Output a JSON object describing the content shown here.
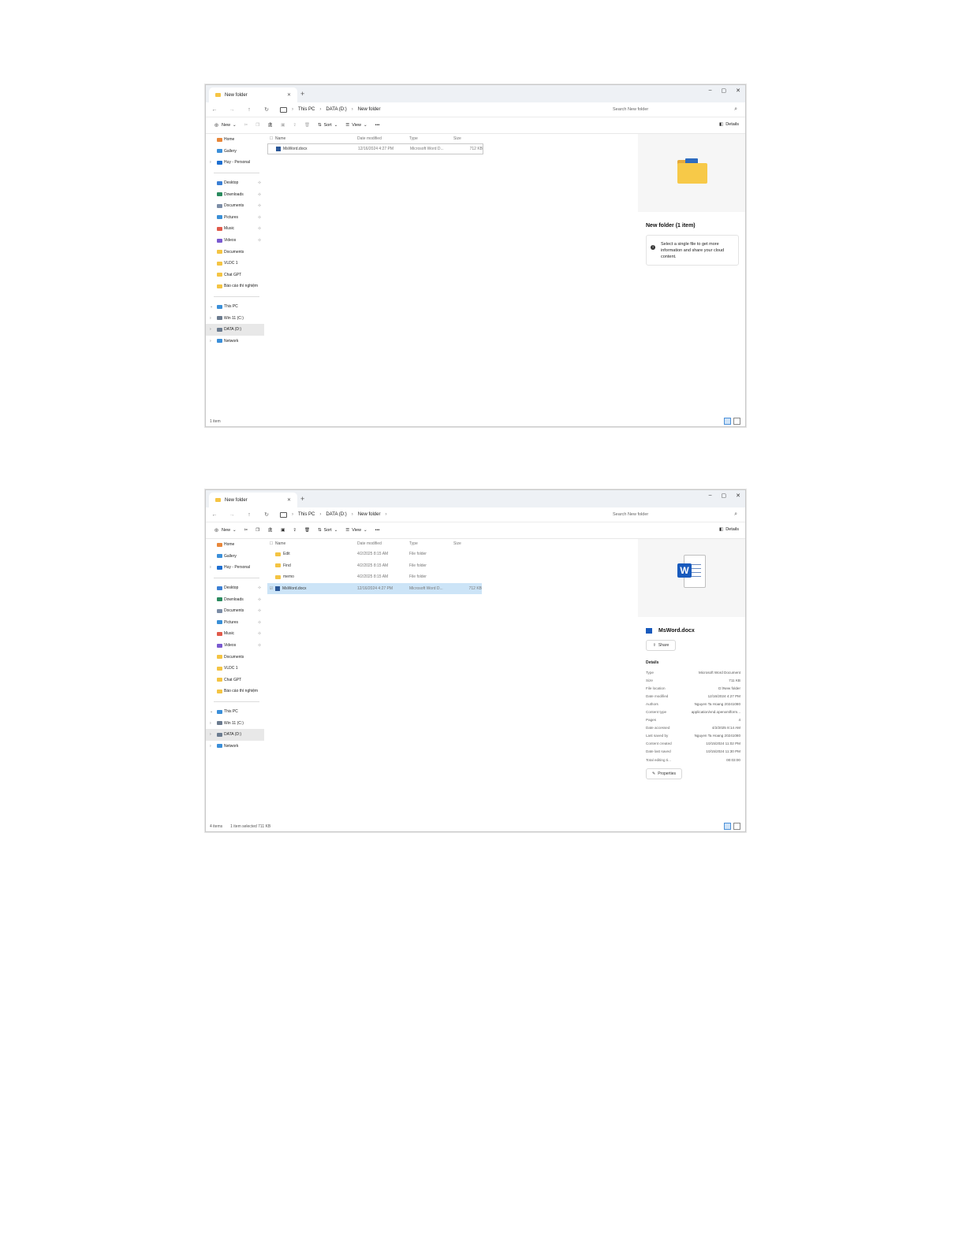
{
  "windows": [
    {
      "title": "New folder",
      "search_placeholder": "Search New folder",
      "breadcrumb": [
        "This PC",
        "DATA (D:)",
        "New folder"
      ],
      "toolbar": {
        "new": "New",
        "sort": "Sort",
        "view": "View",
        "more": "•••",
        "details": "Details"
      },
      "columns": {
        "name": "Name",
        "date": "Date modified",
        "type": "Type",
        "size": "Size"
      },
      "sidebar": {
        "top": [
          {
            "label": "Home",
            "color": "#e8873a"
          },
          {
            "label": "Gallery",
            "color": "#3b8fd9"
          },
          {
            "label": "Huy - Personal",
            "color": "#1e6fd1"
          }
        ],
        "quick": [
          {
            "label": "Desktop",
            "color": "#3b7fd4"
          },
          {
            "label": "Downloads",
            "color": "#2a8a5e"
          },
          {
            "label": "Documents",
            "color": "#7c8da6"
          },
          {
            "label": "Pictures",
            "color": "#3a8fd6"
          },
          {
            "label": "Music",
            "color": "#e05a4a"
          },
          {
            "label": "Videos",
            "color": "#7a5ad0"
          },
          {
            "label": "Documents",
            "color": "#f4c443"
          },
          {
            "label": "VLDC 1",
            "color": "#f4c443"
          },
          {
            "label": "Chat GPT",
            "color": "#f4c443"
          },
          {
            "label": "Báo cáo thí nghiệm",
            "color": "#f4c443"
          }
        ],
        "pc": [
          {
            "label": "This PC",
            "color": "#3b8fd9"
          },
          {
            "label": "Win 11 (C:)",
            "color": "#6b7b8f"
          },
          {
            "label": "DATA (D:)",
            "color": "#6b7b8f"
          },
          {
            "label": "Network",
            "color": "#3b8fd9"
          }
        ]
      },
      "files": [
        {
          "name": "MsWord.docx",
          "date": "12/16/2024 4:27 PM",
          "type": "Microsoft Word D...",
          "size": "712 KB",
          "kind": "word"
        }
      ],
      "details_title": "New folder (1 item)",
      "details_message": "Select a single file to get more information and share your cloud content.",
      "status": "1 item",
      "status_selected": ""
    },
    {
      "title": "New folder",
      "search_placeholder": "Search New folder",
      "breadcrumb": [
        "This PC",
        "DATA (D:)",
        "New folder"
      ],
      "toolbar": {
        "new": "New",
        "sort": "Sort",
        "view": "View",
        "more": "•••",
        "details": "Details"
      },
      "columns": {
        "name": "Name",
        "date": "Date modified",
        "type": "Type",
        "size": "Size"
      },
      "sidebar": {
        "top": [
          {
            "label": "Home",
            "color": "#e8873a"
          },
          {
            "label": "Gallery",
            "color": "#3b8fd9"
          },
          {
            "label": "Huy - Personal",
            "color": "#1e6fd1"
          }
        ],
        "quick": [
          {
            "label": "Desktop",
            "color": "#3b7fd4"
          },
          {
            "label": "Downloads",
            "color": "#2a8a5e"
          },
          {
            "label": "Documents",
            "color": "#7c8da6"
          },
          {
            "label": "Pictures",
            "color": "#3a8fd6"
          },
          {
            "label": "Music",
            "color": "#e05a4a"
          },
          {
            "label": "Videos",
            "color": "#7a5ad0"
          },
          {
            "label": "Documents",
            "color": "#f4c443"
          },
          {
            "label": "VLDC 1",
            "color": "#f4c443"
          },
          {
            "label": "Chat GPT",
            "color": "#f4c443"
          },
          {
            "label": "Báo cáo thí nghiệm",
            "color": "#f4c443"
          }
        ],
        "pc": [
          {
            "label": "This PC",
            "color": "#3b8fd9"
          },
          {
            "label": "Win 11 (C:)",
            "color": "#6b7b8f"
          },
          {
            "label": "DATA (D:)",
            "color": "#6b7b8f"
          },
          {
            "label": "Network",
            "color": "#3b8fd9"
          }
        ]
      },
      "files": [
        {
          "name": "Edit",
          "date": "4/2/2025 8:15 AM",
          "type": "File folder",
          "size": "",
          "kind": "folder"
        },
        {
          "name": "Find",
          "date": "4/2/2025 8:15 AM",
          "type": "File folder",
          "size": "",
          "kind": "folder"
        },
        {
          "name": "memo",
          "date": "4/2/2025 8:15 AM",
          "type": "File folder",
          "size": "",
          "kind": "folder"
        },
        {
          "name": "MsWord.docx",
          "date": "12/16/2024 4:27 PM",
          "type": "Microsoft Word D...",
          "size": "712 KB",
          "kind": "word",
          "selected": true
        }
      ],
      "file_title": "MsWord.docx",
      "share_label": "Share",
      "details_heading": "Details",
      "properties": [
        {
          "k": "Type",
          "v": "Microsoft Word Document"
        },
        {
          "k": "Size",
          "v": "711 KB"
        },
        {
          "k": "File location",
          "v": "D:\\New folder"
        },
        {
          "k": "Date modified",
          "v": "12/16/2024 4:27 PM"
        },
        {
          "k": "Authors",
          "v": "Nguyen Ta Hoang 20241080"
        },
        {
          "k": "Content type",
          "v": "application/vnd.openxmlform..."
        },
        {
          "k": "Pages",
          "v": "4"
        },
        {
          "k": "Date accessed",
          "v": "4/2/2025 8:14 AM"
        },
        {
          "k": "Last saved by",
          "v": "Nguyen Ta Hoang 20241080"
        },
        {
          "k": "Content created",
          "v": "10/15/2024 11:02 PM"
        },
        {
          "k": "Date last saved",
          "v": "10/15/2024 11:30 PM"
        },
        {
          "k": "Total editing ti...",
          "v": "00:03:00"
        }
      ],
      "properties_label": "Properties",
      "status": "4 items",
      "status_selected": "1 item selected  711 KB"
    }
  ]
}
